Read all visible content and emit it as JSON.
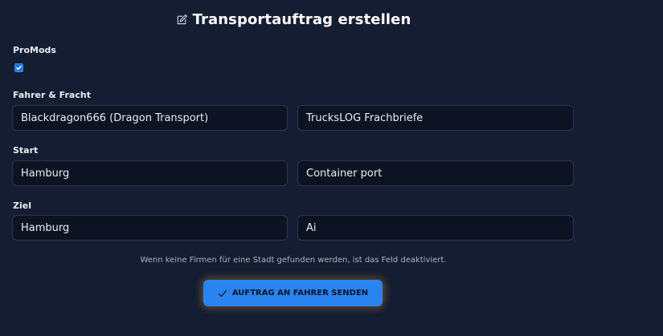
{
  "header": {
    "title": "Transportauftrag erstellen",
    "icon": "edit-icon"
  },
  "promods": {
    "label": "ProMods",
    "checked": true
  },
  "driver_cargo": {
    "label": "Fahrer & Fracht",
    "driver_value": "Blackdragon666 (Dragon Transport)",
    "cargo_value": "TrucksLOG Frachbriefe"
  },
  "start": {
    "label": "Start",
    "city_value": "Hamburg",
    "company_value": "Container port"
  },
  "destination": {
    "label": "Ziel",
    "city_value": "Hamburg",
    "company_value": "Ai"
  },
  "hint_text": "Wenn keine Firmen für eine Stadt gefunden werden, ist das Feld deaktiviert.",
  "submit": {
    "label": "AUFTRAG AN FAHRER SENDEN",
    "icon": "check-icon"
  },
  "colors": {
    "background": "#141d31",
    "field_background": "#0d1322",
    "accent": "#2a84f0",
    "glow": "#ffaa3c"
  }
}
